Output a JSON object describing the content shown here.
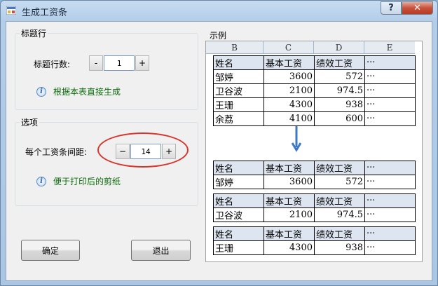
{
  "window": {
    "title": "生成工资条",
    "help": "?",
    "close": "✕"
  },
  "title_group": {
    "label": "标题行",
    "rows_label": "标题行数:",
    "minus": "-",
    "value": "1",
    "plus": "+",
    "info": "根据本表直接生成"
  },
  "options_group": {
    "label": "选项",
    "spacing_label": "每个工资条间距:",
    "minus": "−",
    "value": "14",
    "plus": "+",
    "info": "便于打印后的剪纸"
  },
  "buttons": {
    "ok": "确定",
    "exit": "退出"
  },
  "example": {
    "label": "示例",
    "columns": [
      "B",
      "C",
      "D",
      "E"
    ],
    "headers": [
      "姓名",
      "基本工资",
      "绩效工资",
      "···"
    ],
    "rows": [
      [
        "邹婷",
        "3600",
        "572",
        "···"
      ],
      [
        "卫谷波",
        "2100",
        "974.5",
        "···"
      ],
      [
        "王珊",
        "4300",
        "938",
        "···"
      ],
      [
        "余荔",
        "4100",
        "600",
        "···"
      ]
    ],
    "slips": [
      [
        "邹婷",
        "3600",
        "572",
        "···"
      ],
      [
        "卫谷波",
        "2100",
        "974.5",
        "···"
      ],
      [
        "王珊",
        "4300",
        "938",
        "···"
      ]
    ]
  },
  "colors": {
    "info_text": "#0b6b0b",
    "highlight": "#d9342b",
    "arrow": "#3d79c2"
  }
}
